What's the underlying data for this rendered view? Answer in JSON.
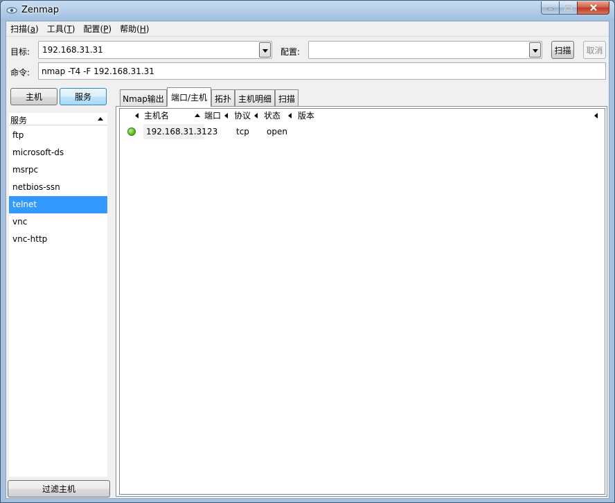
{
  "window": {
    "title": "Zenmap"
  },
  "menu": [
    {
      "label": "扫描(",
      "key": "a",
      "suffix": ")"
    },
    {
      "label": "工具(",
      "key": "T",
      "suffix": ")"
    },
    {
      "label": "配置(",
      "key": "P",
      "suffix": ")"
    },
    {
      "label": "帮助(",
      "key": "H",
      "suffix": ")"
    }
  ],
  "target": {
    "label": "目标:",
    "value": "192.168.31.31"
  },
  "profile": {
    "label": "配置:",
    "value": ""
  },
  "buttons": {
    "scan": "扫描",
    "cancel": "取消"
  },
  "command": {
    "label": "命令:",
    "value": "nmap -T4 -F 192.168.31.31"
  },
  "left_toggle": {
    "hosts": "主机",
    "services": "服务"
  },
  "services": {
    "header": "服务",
    "items": [
      "ftp",
      "microsoft-ds",
      "msrpc",
      "netbios-ssn",
      "telnet",
      "vnc",
      "vnc-http"
    ],
    "selected": "telnet"
  },
  "filter_button": "过滤主机",
  "tabs": [
    "Nmap输出",
    "端口/主机",
    "拓扑",
    "主机明细",
    "扫描"
  ],
  "active_tab": "端口/主机",
  "ports_table": {
    "columns": [
      "主机名",
      "端口",
      "协议",
      "状态",
      "版本"
    ],
    "rows": [
      {
        "host": "192.168.31.31",
        "port": "23",
        "protocol": "tcp",
        "state": "open",
        "version": "",
        "status_color": "#5fbf2a"
      }
    ]
  }
}
